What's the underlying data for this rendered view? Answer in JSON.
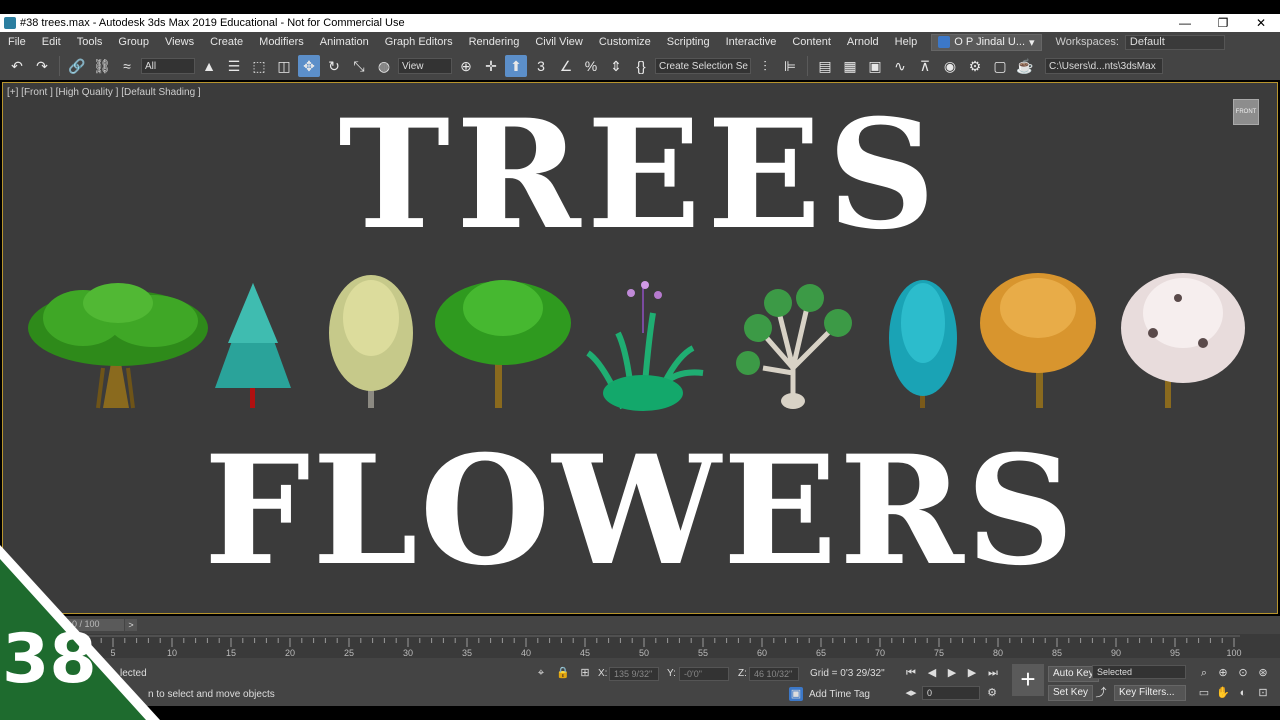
{
  "window": {
    "title": "#38 trees.max - Autodesk 3ds Max 2019 Educational - Not for Commercial Use",
    "minimize": "—",
    "maximize": "❐",
    "close": "✕"
  },
  "menu": {
    "items": [
      "File",
      "Edit",
      "Tools",
      "Group",
      "Views",
      "Create",
      "Modifiers",
      "Animation",
      "Graph Editors",
      "Rendering",
      "Civil View",
      "Customize",
      "Scripting",
      "Interactive",
      "Content",
      "Arnold",
      "Help"
    ],
    "user": "O P Jindal U...",
    "workspaces_label": "Workspaces:",
    "workspace_value": "Default"
  },
  "toolbar": {
    "filter_value": "All",
    "refcoord_value": "View",
    "selection_set_placeholder": "Create Selection Se",
    "path_value": "C:\\Users\\d...nts\\3dsMax"
  },
  "viewport": {
    "label": "[+] [Front ] [High Quality ] [Default Shading ]",
    "viewcube_label": "FRONT",
    "headline_top": "TREES",
    "headline_bottom": "FLOWERS",
    "accent_border": "#b8952d"
  },
  "timeline": {
    "slider_value": "0 / 100",
    "next_arrow": ">",
    "ticks": [
      "5",
      "10",
      "15",
      "20",
      "25",
      "30",
      "35",
      "40",
      "45",
      "50",
      "55",
      "60",
      "65",
      "70",
      "75",
      "80",
      "85",
      "90",
      "95",
      "100"
    ]
  },
  "status": {
    "selected_text": "lected",
    "prompt_text": "n to select and move objects",
    "x_label": "X:",
    "x_value": "135 9/32\"",
    "y_label": "Y:",
    "y_value": "-0'0\"",
    "z_label": "Z:",
    "z_value": "46 10/32\"",
    "grid_text": "Grid = 0'3 29/32\"",
    "add_time_tag": "Add Time Tag",
    "auto_key": "Auto Key",
    "set_key": "Set Key",
    "selected_dropdown": "Selected",
    "key_filters": "Key Filters...",
    "frame_value": "0"
  },
  "badge": {
    "number": "38",
    "color": "#1e6b2e"
  }
}
